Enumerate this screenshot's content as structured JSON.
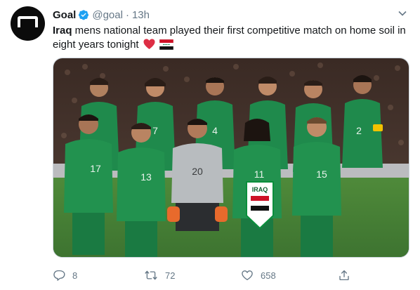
{
  "tweet": {
    "author_name": "Goal",
    "author_handle": "@goal",
    "separator": "·",
    "time": "13h",
    "text_bold": "Iraq",
    "text_rest": " mens national team played their first competitive match on home soil in eight years tonight",
    "emojis": [
      "red-heart",
      "iraq-flag"
    ]
  },
  "photo": {
    "pennant_text": "IRAQ",
    "player_numbers": [
      "7",
      "4",
      "",
      "",
      "2",
      "17",
      "13",
      "20",
      "11",
      "15"
    ]
  },
  "actions": {
    "reply_count": "8",
    "retweet_count": "72",
    "like_count": "658"
  },
  "colors": {
    "link_blue": "#1da1f2",
    "secondary_text": "#657786",
    "heart_red": "#e0245e",
    "kit_green": "#1f8a4c",
    "goalkeeper_grey": "#b8bcbf"
  },
  "icons": [
    "goal-logo-icon",
    "verified-badge-icon",
    "chevron-down-icon",
    "reply-icon",
    "retweet-icon",
    "like-icon",
    "share-icon"
  ]
}
